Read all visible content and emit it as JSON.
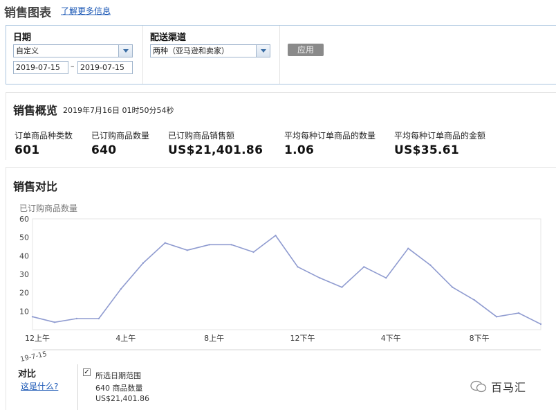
{
  "header": {
    "title": "销售图表",
    "learn_more": "了解更多信息"
  },
  "filters": {
    "date_label": "日期",
    "date_range_value": "自定义",
    "start_date": "2019-07-15",
    "end_date": "2019-07-15",
    "date_separator": "–",
    "channel_label": "配送渠道",
    "channel_value": "两种（亚马逊和卖家）",
    "apply_label": "应用"
  },
  "summary": {
    "title": "销售概览",
    "timestamp": "2019年7月16日 01时50分54秒",
    "metrics": [
      {
        "label": "订单商品种类数",
        "value": "601"
      },
      {
        "label": "已订购商品数量",
        "value": "640"
      },
      {
        "label": "已订购商品销售额",
        "value": "US$21,401.86"
      },
      {
        "label": "平均每种订单商品的数量",
        "value": "1.06"
      },
      {
        "label": "平均每种订单商品的金额",
        "value": "US$35.61"
      }
    ]
  },
  "comparison": {
    "title": "销售对比",
    "compare_label": "对比",
    "whats_this": "这是什么?",
    "legend": {
      "checkbox_mark": "✓",
      "series_name": "所选日期范围",
      "units_line": "640 商品数量",
      "sales_line": "US$21,401.86"
    }
  },
  "chart_data": {
    "type": "line",
    "ylabel": "已订购商品数量",
    "ylim": [
      0,
      60
    ],
    "yticks": [
      10,
      20,
      30,
      40,
      50,
      60
    ],
    "x_tick_labels": [
      "12上午",
      "4上午",
      "8上午",
      "12下午",
      "4下午",
      "8下午"
    ],
    "date_label": "19-7-15",
    "x": [
      0,
      1,
      2,
      3,
      4,
      5,
      6,
      7,
      8,
      9,
      10,
      11,
      12,
      13,
      14,
      15,
      16,
      17,
      18,
      19,
      20,
      21,
      22,
      23
    ],
    "series": [
      {
        "color": "#8f9bd0",
        "values": [
          7,
          4,
          6,
          6,
          22,
          36,
          47,
          43,
          46,
          46,
          42,
          51,
          34,
          28,
          23,
          34,
          28,
          44,
          35,
          23,
          16,
          7,
          9,
          3
        ]
      }
    ],
    "grid": false
  },
  "watermark": {
    "text": "百马汇"
  },
  "colors": {
    "link": "#1a57b5",
    "line": "#8f9bd0",
    "panel_border": "#a9c4de"
  }
}
